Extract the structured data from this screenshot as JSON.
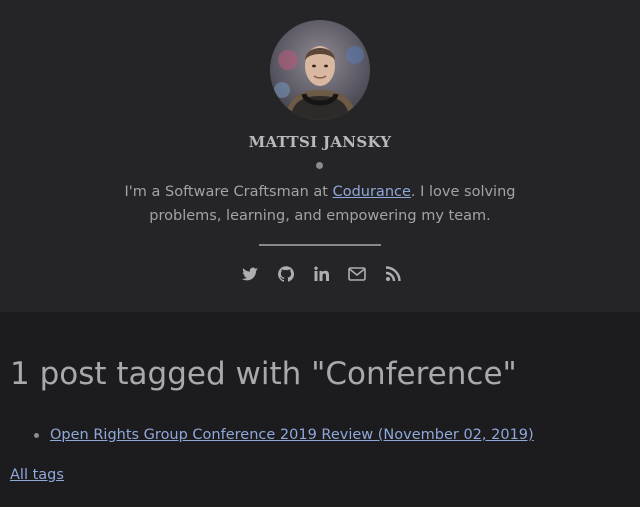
{
  "header": {
    "site_name": "MATTSI JANSKY",
    "bio": {
      "prefix": "I'm a Software Craftsman at ",
      "company_link": "Codurance",
      "suffix": ". I love solving problems, learning, and empowering my team."
    },
    "social_links": [
      {
        "icon": "twitter-icon"
      },
      {
        "icon": "github-icon"
      },
      {
        "icon": "linkedin-icon"
      },
      {
        "icon": "envelope-icon"
      },
      {
        "icon": "rss-icon"
      }
    ]
  },
  "main": {
    "heading": "1 post tagged with \"Conference\"",
    "posts": [
      {
        "title": "Open Rights Group Conference 2019 Review (November 02, 2019)"
      }
    ],
    "all_tags_label": "All tags"
  },
  "colors": {
    "header_bg": "#252527",
    "page_bg": "#1c1c1e",
    "link": "#8fa7d9",
    "text": "#a7a7aa"
  }
}
